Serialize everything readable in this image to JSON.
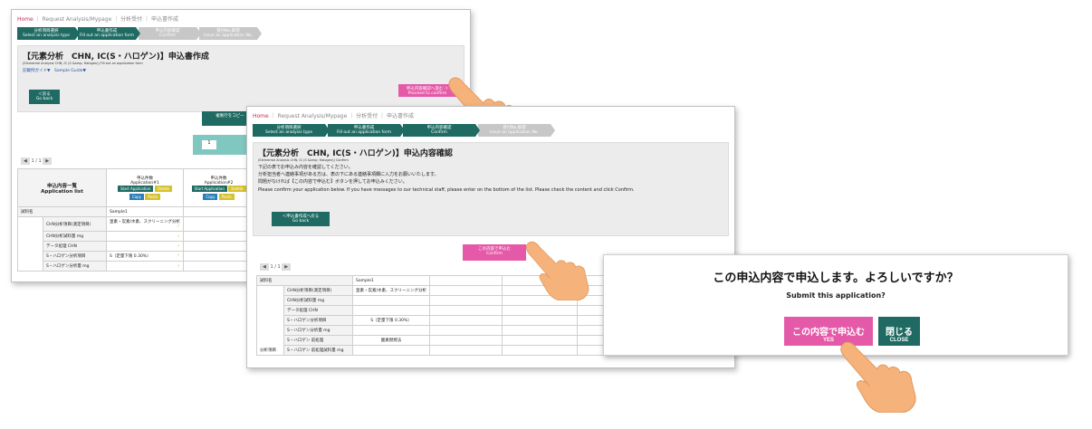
{
  "shot1": {
    "breadcrumb": [
      "Home",
      "Request Analysis/Mypage",
      "分析受付",
      "申込書作成"
    ],
    "steps": [
      {
        "jp": "分析項目選択",
        "en": "Select an analysis type"
      },
      {
        "jp": "申込書作成",
        "en": "Fill out an application form"
      },
      {
        "jp": "申込内容確認",
        "en": "Confirm"
      },
      {
        "jp": "受付No.取得",
        "en": "Issue an application No."
      }
    ],
    "title": "【元素分析　CHN, IC(S・ハロゲン)】申込書作成",
    "subtitle": "(Elemental Analysis CHN, IC (S &amp; Halogen)) Fill out an application form",
    "guide": "記載例ガイド▼　Sample Guide▼",
    "back_button": {
      "jp": "＜戻る",
      "en": "Go back"
    },
    "confirm_button": {
      "jp": "申込内容確認へ進む ＞",
      "en": "Proceed to confirm"
    },
    "copy_button": {
      "jp": "複製行をコピー",
      "en": "Copy table rows"
    },
    "page_indicator": "1 / 1",
    "list_header": {
      "jp": "申込内容一覧",
      "en": "Application list"
    },
    "app_columns": [
      {
        "jp": "申込件数",
        "en": "Application#1"
      },
      {
        "jp": "申込件数",
        "en": "Application#2"
      }
    ],
    "start_application": "Start Application",
    "delete_label": "Delete",
    "copy_label": "Copy",
    "paste_label": "Paste",
    "sample_label": "試料名",
    "sample_value": "Sample1",
    "rows": [
      "CHN分析項目(測定項目)",
      "CHN分析試料量 mg",
      "データ処理 CHN",
      "S・ハロゲン分析項目",
      "S・ハロゲン分析量 mg"
    ],
    "row_values": [
      "窒素・炭素/水素、スクリーニング分析",
      "",
      "",
      "S（定量下限 0.30%）",
      ""
    ]
  },
  "shot2": {
    "breadcrumb": [
      "Home",
      "Request Analysis/Mypage",
      "分析受付",
      "申込書作成"
    ],
    "steps": [
      {
        "jp": "分析項目選択",
        "en": "Select an analysis type"
      },
      {
        "jp": "申込書作成",
        "en": "Fill out an application form"
      },
      {
        "jp": "申込内容確認",
        "en": "Confirm"
      },
      {
        "jp": "受付No.取得",
        "en": "Issue an application No."
      }
    ],
    "title": "【元素分析　CHN, IC(S・ハロゲン)】申込内容確認",
    "subtitle": "(Elemental Analysis CHN, IC (S &amp; Halogen)) Confirm",
    "instructions": [
      "下記の表でお申込み内容を確認してください。",
      "分析担当者へ連絡事項がある方は、表の下にある連絡事項欄に入力をお願いいたします。",
      "問題がなければ【この内容で申込む】ボタンを押してお申込みください。",
      "Please confirm your application below. If you have messages to our technical staff, please enter on the bottom of the list. Please check the content and click Confirm."
    ],
    "back_button": {
      "jp": "＜申込書作成へ戻る",
      "en": "Go back"
    },
    "submit_button": {
      "jp": "この内容で申込む",
      "en": "Confirm"
    },
    "page_indicator": "1 / 1",
    "sample_label": "試料名",
    "sample_value": "Sample1",
    "group_label": "分析項目",
    "rows": [
      "CHN分析項目(測定項目)",
      "CHN分析試料量 mg",
      "データ処理 CHN",
      "S・ハロゲン分析項目",
      "S・ハロゲン分析量 mg",
      "S・ハロゲン 前処理",
      "S・ハロゲン 前処理試料量 mg"
    ],
    "row_values": [
      "窒素・炭素/水素、スクリーニング分析",
      "",
      "",
      "S（定量下限 0.30%）",
      "",
      "酸素燃焼法",
      ""
    ]
  },
  "dialog": {
    "title": "この申込内容で申込します。よろしいですか？",
    "subtitle": "Submit this application?",
    "yes": {
      "jp": "この内容で申込む",
      "en": "YES"
    },
    "close": {
      "jp": "閉じる",
      "en": "CLOSE"
    }
  },
  "colors": {
    "teal": "#1f6b63",
    "pink": "#e55aa8",
    "check": "#d6c22d",
    "hand": "#f5b27a"
  }
}
